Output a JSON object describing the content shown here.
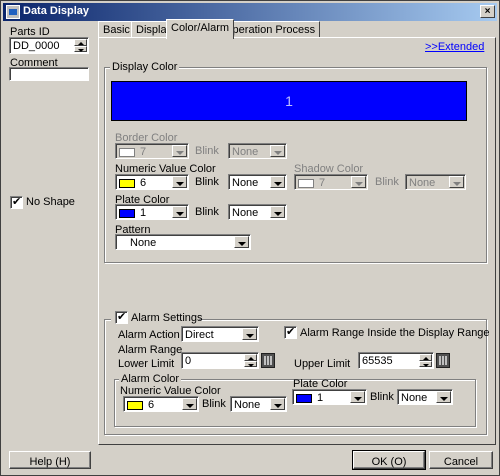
{
  "window": {
    "title": "Data Display",
    "close_glyph": "×"
  },
  "left": {
    "parts_id_label": "Parts ID",
    "parts_id_value": "DD_0000",
    "comment_label": "Comment",
    "comment_value": "",
    "no_shape_label": "No Shape",
    "no_shape_checked": true
  },
  "tabs": [
    {
      "label": "Basic",
      "active": false
    },
    {
      "label": "Display",
      "active": false
    },
    {
      "label": "Color/Alarm",
      "active": true
    },
    {
      "label": "Operation Process",
      "active": false
    }
  ],
  "extended_link": ">>Extended",
  "display_color": {
    "group_label": "Display Color",
    "preview_value": "1",
    "preview_color": "#0000ff",
    "border_color": {
      "label": "Border Color",
      "value": "7",
      "swatch": "#ffffff",
      "blink_label": "Blink",
      "blink_value": "None",
      "disabled": true
    },
    "numeric_value_color": {
      "label": "Numeric Value Color",
      "value": "6",
      "swatch": "#ffff00",
      "blink_label": "Blink",
      "blink_value": "None"
    },
    "shadow_color": {
      "label": "Shadow Color",
      "value": "7",
      "swatch": "#ffffff",
      "blink_label": "Blink",
      "blink_value": "None",
      "disabled": true
    },
    "plate_color": {
      "label": "Plate Color",
      "value": "1",
      "swatch": "#0000ff",
      "blink_label": "Blink",
      "blink_value": "None"
    },
    "pattern": {
      "label": "Pattern",
      "value": "None"
    }
  },
  "alarm": {
    "settings_label": "Alarm Settings",
    "settings_checked": true,
    "action_label": "Alarm Action",
    "action_value": "Direct",
    "range_inside_label": "Alarm Range Inside the Display Range",
    "range_inside_checked": true,
    "range_label": "Alarm Range",
    "lower_limit_label": "Lower Limit",
    "lower_limit_value": "0",
    "upper_limit_label": "Upper Limit",
    "upper_limit_value": "65535",
    "color_group_label": "Alarm Color",
    "numeric_value_color": {
      "label": "Numeric Value Color",
      "value": "6",
      "swatch": "#ffff00",
      "blink_label": "Blink",
      "blink_value": "None"
    },
    "plate_color": {
      "label": "Plate Color",
      "value": "1",
      "swatch": "#0000ff",
      "blink_label": "Blink",
      "blink_value": "None"
    }
  },
  "buttons": {
    "help": "Help (H)",
    "ok": "OK (O)",
    "cancel": "Cancel"
  }
}
